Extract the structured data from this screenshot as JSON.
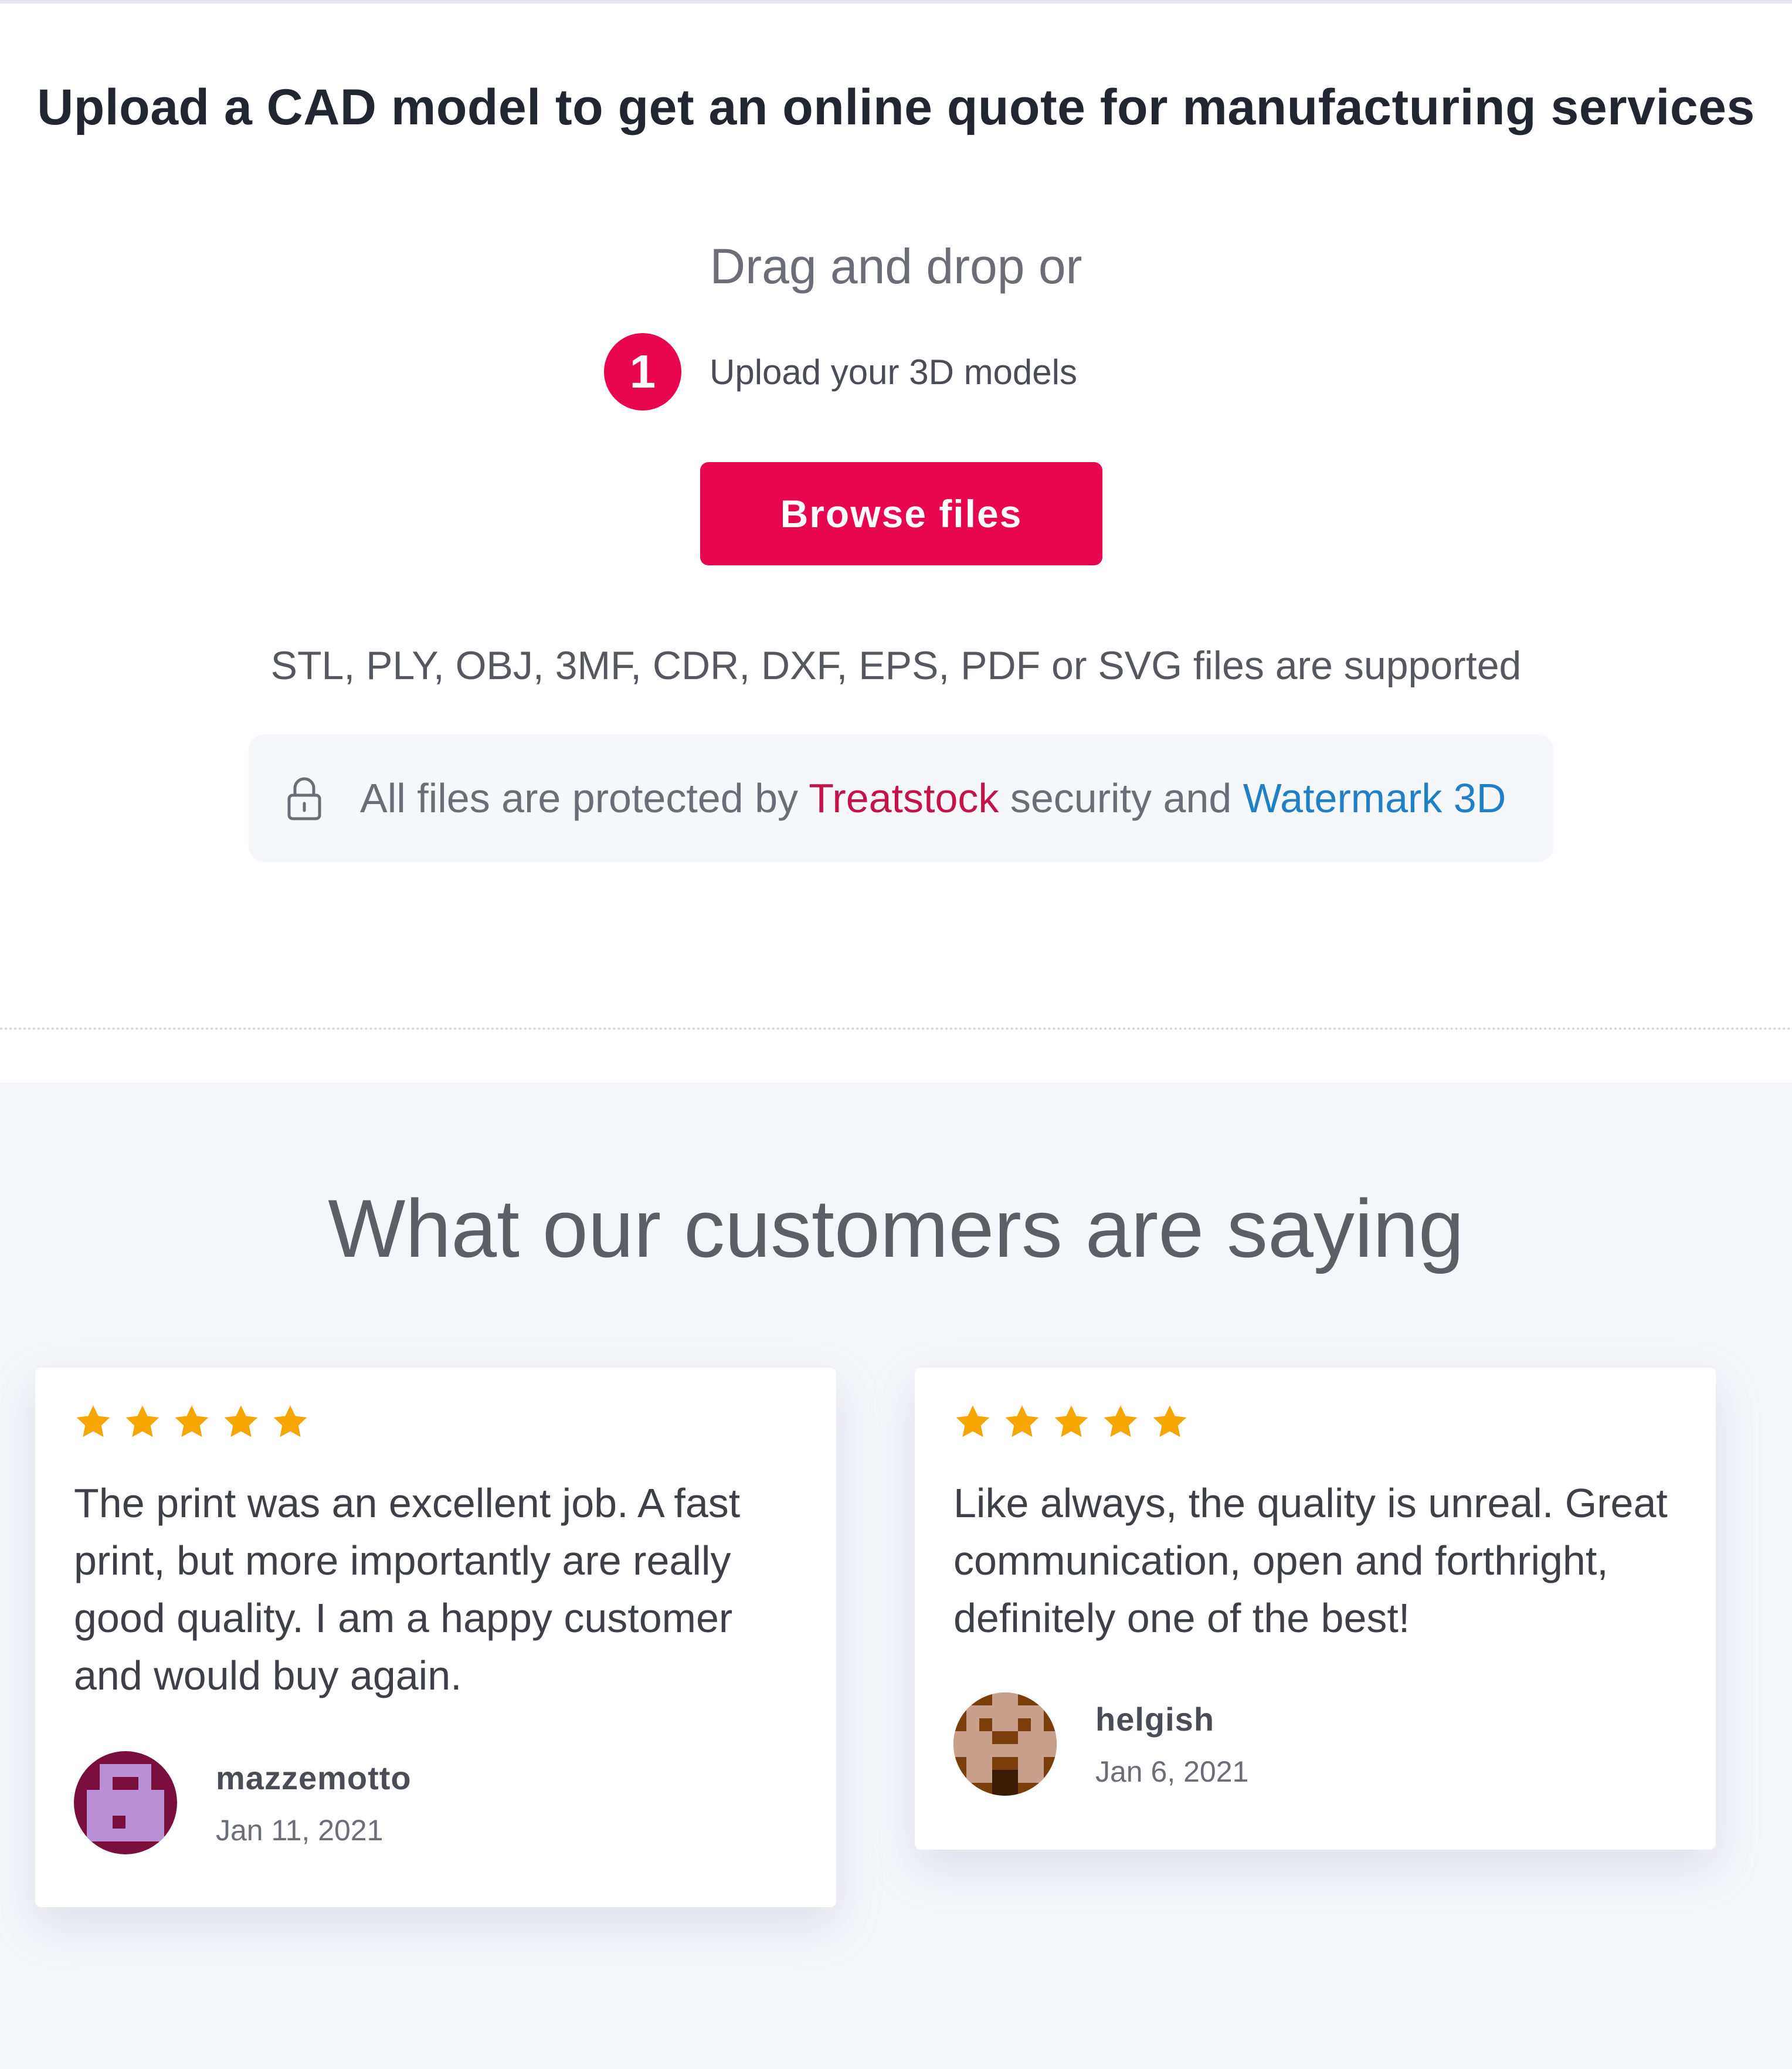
{
  "upload": {
    "title": "Upload a CAD model to get an online quote for manufacturing services",
    "drag_text": "Drag and drop or",
    "step_number": "1",
    "step_label": "Upload your 3D models",
    "browse_label": "Browse files",
    "formats_text": "STL, PLY, OBJ, 3MF, CDR, DXF, EPS, PDF or SVG files are supported",
    "security": {
      "prefix": "All files are protected by ",
      "brand": "Treatstock",
      "middle": " security and ",
      "watermark": "Watermark 3D"
    }
  },
  "reviews": {
    "title": "What our customers are saying",
    "items": [
      {
        "rating": 5,
        "text": "The print was an excellent job. A fast print, but more importantly are really good quality. I am a happy customer and would buy again.",
        "author": "mazzemotto",
        "date": "Jan 11, 2021"
      },
      {
        "rating": 5,
        "text": "Like always, the quality is unreal. Great communication, open and forthright, definitely one of the best!",
        "author": "helgish",
        "date": "Jan 6, 2021"
      }
    ]
  },
  "colors": {
    "accent": "#e8064e",
    "brand": "#c4134a",
    "link": "#1f7fc7",
    "star": "#f7a600",
    "section_bg": "#f5f6fa"
  },
  "icons": [
    "lock-icon",
    "star-icon",
    "avatar"
  ]
}
